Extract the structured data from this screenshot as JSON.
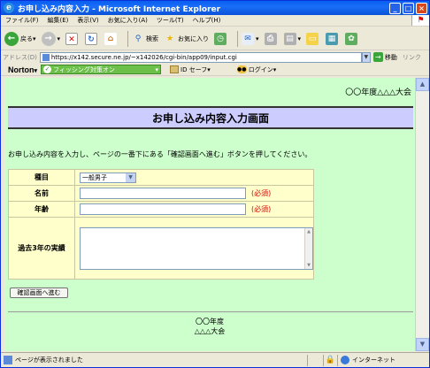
{
  "window": {
    "title": "お申し込み内容入力 - Microsoft Internet Explorer",
    "minimize": "_",
    "maximize": "□",
    "close": "×"
  },
  "menu": {
    "items": [
      "ファイル(F)",
      "編集(E)",
      "表示(V)",
      "お気に入り(A)",
      "ツール(T)",
      "ヘルプ(H)"
    ]
  },
  "toolbar": {
    "back_label": "戻る",
    "search_label": "検索",
    "favorites_label": "お気に入り"
  },
  "address": {
    "label": "アドレス(D)",
    "url": "https://x142.secure.ne.jp/~x142026/cgi-bin/app09/input.cgi",
    "go_label": "移動",
    "links_label": "リンク"
  },
  "norton": {
    "logo": "Norton",
    "phishing_label": "フィッシング対策オン",
    "idsafe_label": "ID セーフ",
    "login_label": "ログイン"
  },
  "page": {
    "org_top": "〇〇年度△△△大会",
    "heading": "お申し込み内容入力画面",
    "instruction": "お申し込み内容を入力し、ページの一番下にある「確認画面へ進む」ボタンを押してください。",
    "form": {
      "category_label": "種目",
      "category_value": "一般男子",
      "name_label": "名前",
      "name_required": "(必須)",
      "age_label": "年齢",
      "age_required": "(必須)",
      "record_label": "過去3年の実績"
    },
    "confirm_button": "確認画面へ進む",
    "footer_line1": "〇〇年度",
    "footer_line2": "△△△大会"
  },
  "status": {
    "text": "ページが表示されました",
    "zone": "インターネット"
  }
}
